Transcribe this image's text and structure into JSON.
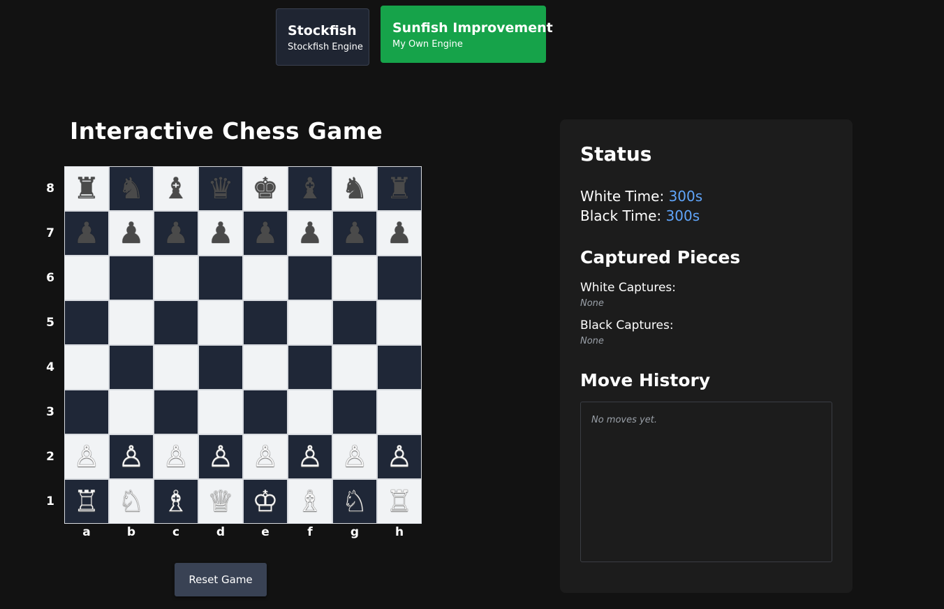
{
  "engines": [
    {
      "name": "Stockfish",
      "subtitle": "Stockfish Engine",
      "active": false
    },
    {
      "name": "Sunfish Improvement",
      "subtitle": "My Own Engine",
      "active": true
    }
  ],
  "game": {
    "title": "Interactive Chess Game",
    "reset_label": "Reset Game"
  },
  "board": {
    "files": [
      "a",
      "b",
      "c",
      "d",
      "e",
      "f",
      "g",
      "h"
    ],
    "ranks": [
      "8",
      "7",
      "6",
      "5",
      "4",
      "3",
      "2",
      "1"
    ],
    "rows": [
      [
        "♜",
        "♞",
        "♝",
        "♛",
        "♚",
        "♝",
        "♞",
        "♜"
      ],
      [
        "♟",
        "♟",
        "♟",
        "♟",
        "♟",
        "♟",
        "♟",
        "♟"
      ],
      [
        "",
        "",
        "",
        "",
        "",
        "",
        "",
        ""
      ],
      [
        "",
        "",
        "",
        "",
        "",
        "",
        "",
        ""
      ],
      [
        "",
        "",
        "",
        "",
        "",
        "",
        "",
        ""
      ],
      [
        "",
        "",
        "",
        "",
        "",
        "",
        "",
        ""
      ],
      [
        "♙",
        "♙",
        "♙",
        "♙",
        "♙",
        "♙",
        "♙",
        "♙"
      ],
      [
        "♖",
        "♘",
        "♗",
        "♕",
        "♔",
        "♗",
        "♘",
        "♖"
      ]
    ],
    "colors": {
      "light": "#f1f3f5",
      "dark": "#1f2737"
    }
  },
  "status": {
    "heading": "Status",
    "white_time_label": "White Time:",
    "white_time_value": "300s",
    "black_time_label": "Black Time:",
    "black_time_value": "300s"
  },
  "captured": {
    "heading": "Captured Pieces",
    "white_label": "White Captures:",
    "white_value": "None",
    "black_label": "Black Captures:",
    "black_value": "None"
  },
  "history": {
    "heading": "Move History",
    "empty_text": "No moves yet."
  },
  "colors": {
    "background": "#121212",
    "panel": "#1c1c1c",
    "accent_green": "#16a34a",
    "time_blue": "#60a5fa"
  }
}
